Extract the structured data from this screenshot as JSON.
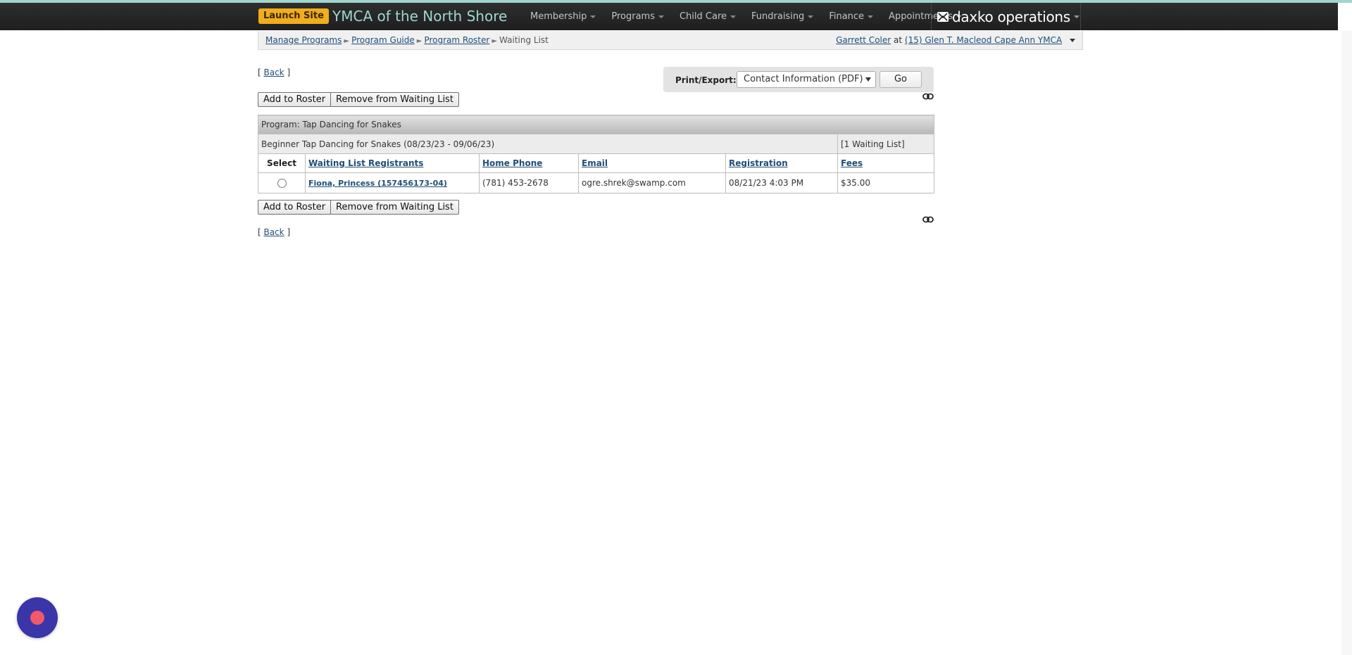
{
  "topbar": {
    "launch_label": "Launch Site",
    "org_name": "YMCA of the North Shore",
    "nav": [
      {
        "label": "Membership"
      },
      {
        "label": "Programs"
      },
      {
        "label": "Child Care"
      },
      {
        "label": "Fundraising"
      },
      {
        "label": "Finance"
      },
      {
        "label": "Appointments"
      }
    ],
    "brand_label": "daxko operations"
  },
  "breadcrumb": {
    "items": [
      "Manage Programs",
      "Program Guide",
      "Program Roster"
    ],
    "current": "Waiting List",
    "user": "Garrett Coler",
    "at_label": "at",
    "location": "(15) Glen T. Macleod Cape Ann YMCA"
  },
  "actions": {
    "back_label": "Back",
    "add_to_roster": "Add to Roster",
    "remove_from_waiting_list": "Remove from Waiting List"
  },
  "export": {
    "label": "Print/Export:",
    "selected": "Contact Information (PDF)",
    "go_label": "Go"
  },
  "program": {
    "title": "Program: Tap Dancing for Snakes",
    "session": "Beginner Tap Dancing for Snakes (08/23/23 - 09/06/23)",
    "waiting_count": "[1 Waiting List]"
  },
  "table": {
    "columns": [
      "Select",
      "Waiting List Registrants",
      "Home Phone",
      "Email",
      "Registration",
      "Fees"
    ],
    "rows": [
      {
        "registrant": "Fiona, Princess (157456173-04)",
        "home_phone": "(781) 453-2678",
        "email": "ogre.shrek@swamp.com",
        "registration": "08/21/23 4:03 PM",
        "fees": "$35.00"
      }
    ]
  },
  "colors": {
    "topbar": "#262626",
    "accent_launch": "#f0ad1c",
    "org_name": "#9ed6d2",
    "link": "#1f4e79",
    "chat_bubble": "#3a35a8",
    "chat_dot": "#f2586b"
  },
  "icons": [
    "link-icon",
    "chat-icon",
    "envelope-icon"
  ]
}
